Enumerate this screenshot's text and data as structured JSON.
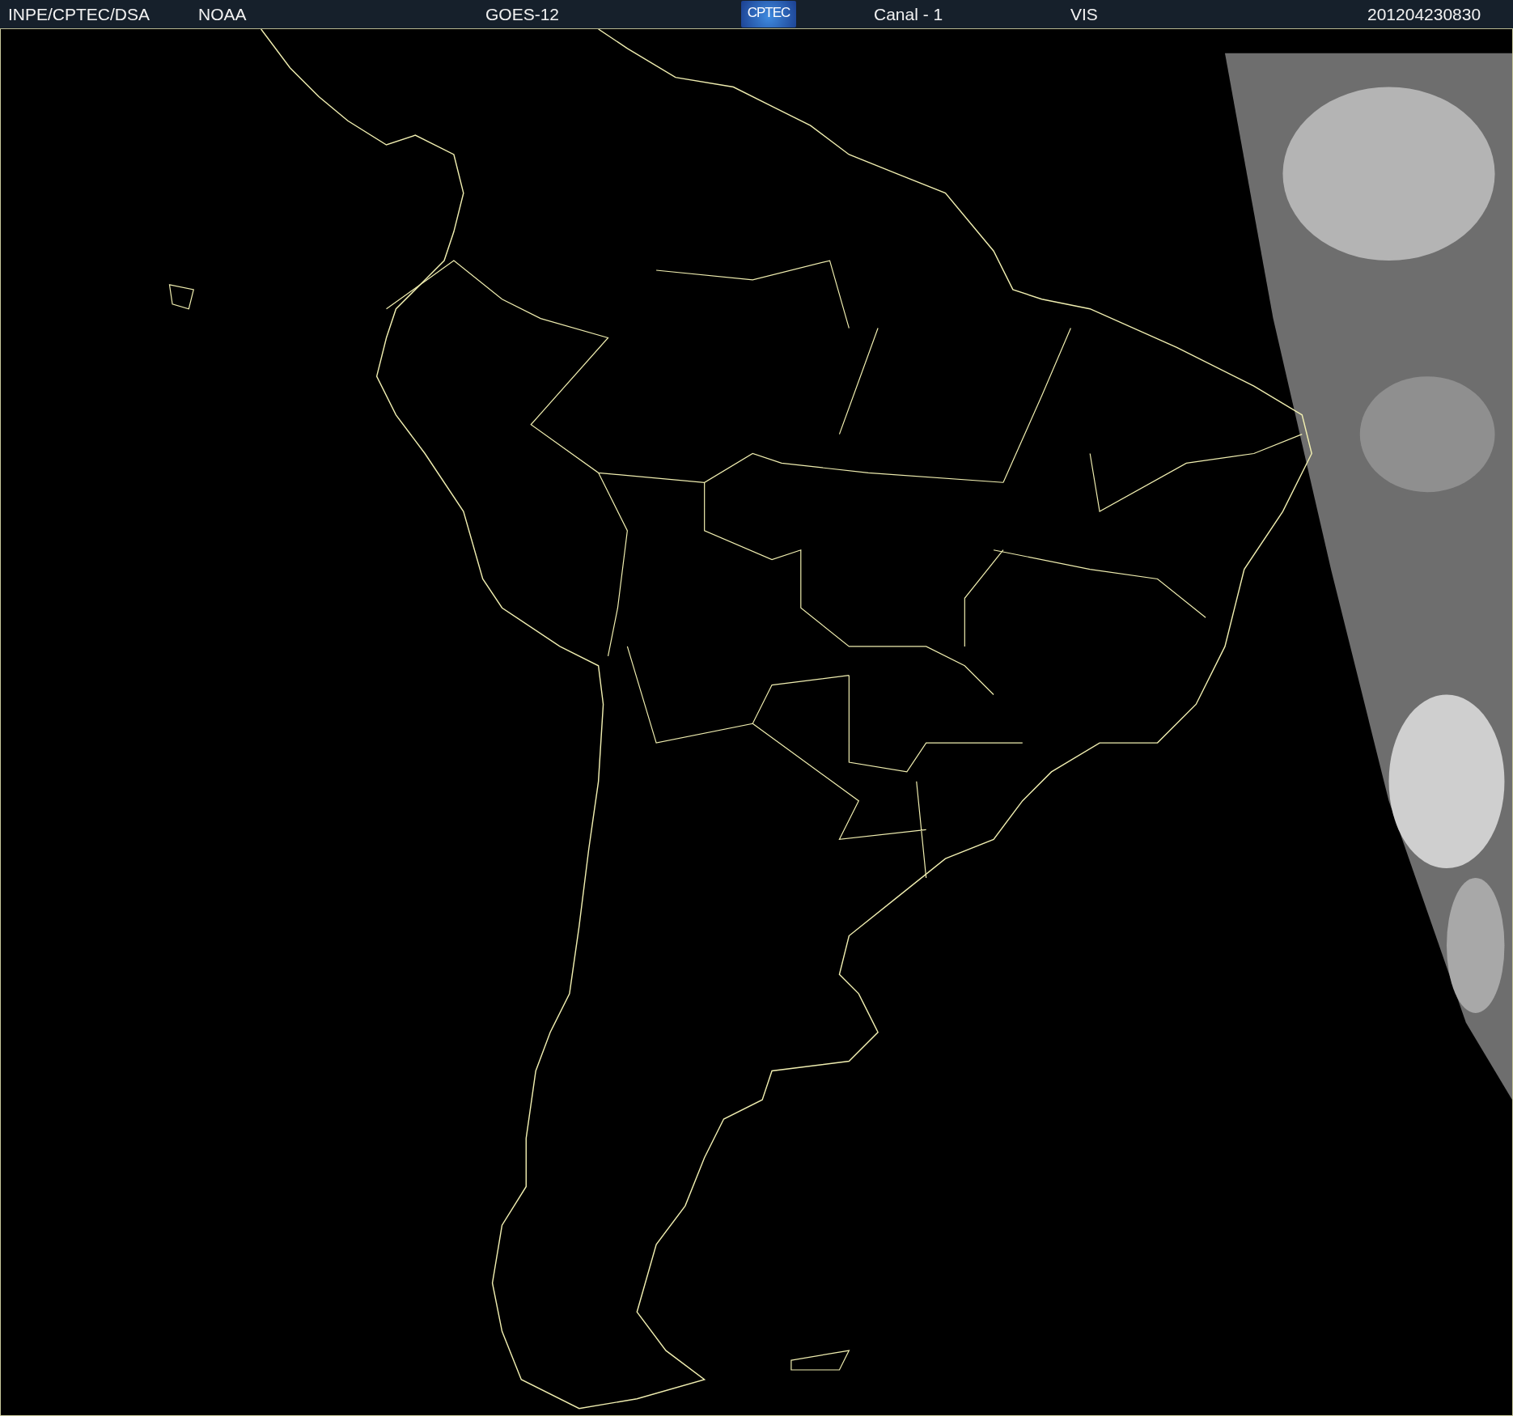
{
  "header": {
    "items": [
      {
        "kind": "text",
        "text": "INPE/CPTEC/DSA"
      },
      {
        "kind": "text",
        "text": "NOAA"
      },
      {
        "kind": "text",
        "text": "GOES-12"
      },
      {
        "kind": "logo",
        "text": "CPTEC"
      },
      {
        "kind": "text",
        "text": "Canal - 1"
      },
      {
        "kind": "text",
        "text": "VIS"
      },
      {
        "kind": "text",
        "text": "201204230830"
      }
    ]
  }
}
